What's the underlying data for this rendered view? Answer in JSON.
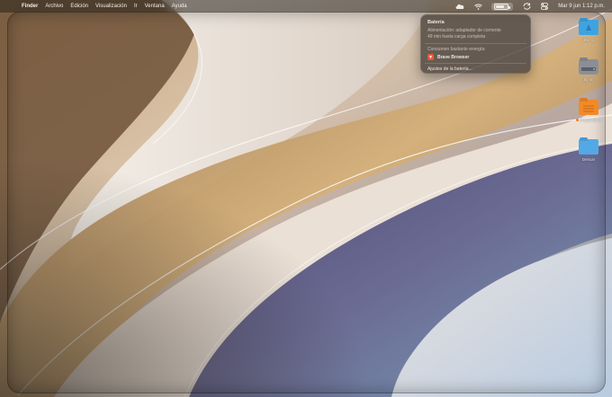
{
  "menubar": {
    "apple_symbol": "",
    "app_name": "Finder",
    "menus": [
      "Archivo",
      "Edición",
      "Visualización",
      "Ir",
      "Ventana",
      "Ayuda"
    ],
    "battery_level": 0.75,
    "clock": "Mar 9 jun  1:12 p.m.",
    "icons": [
      "cloud-icon",
      "wifi-icon",
      "battery-icon",
      "sync-icon",
      "control-center-icon",
      "search-icon"
    ]
  },
  "battery_popup": {
    "title": "Batería",
    "power_source": "Alimentación: adaptador de corriente",
    "time_to_full": "49 min hasta carga completa",
    "energy_heading": "Consumen bastante energía:",
    "apps": [
      {
        "name": "Brave Browser",
        "icon": "brave-icon"
      }
    ],
    "settings_label": "Ajustes de la batería..."
  },
  "desktop_icons": [
    {
      "label": "dev ☺",
      "color": "#3fa3e0",
      "icon": "folder-icon"
    },
    {
      "label": "tty sc",
      "color": "#8a8f97",
      "icon": "drive-icon"
    },
    {
      "label": "Proyectos 3",
      "color": "#f28a26",
      "icon": "folder-icon"
    },
    {
      "label": "Descar",
      "color": "#53a9e6",
      "icon": "folder-icon"
    }
  ],
  "colors": {
    "wallpaper_light": "#f1ebe3",
    "wallpaper_gold": "#b98f5a",
    "wallpaper_purple": "#5d5a86",
    "wallpaper_blue": "#6e95b6"
  }
}
